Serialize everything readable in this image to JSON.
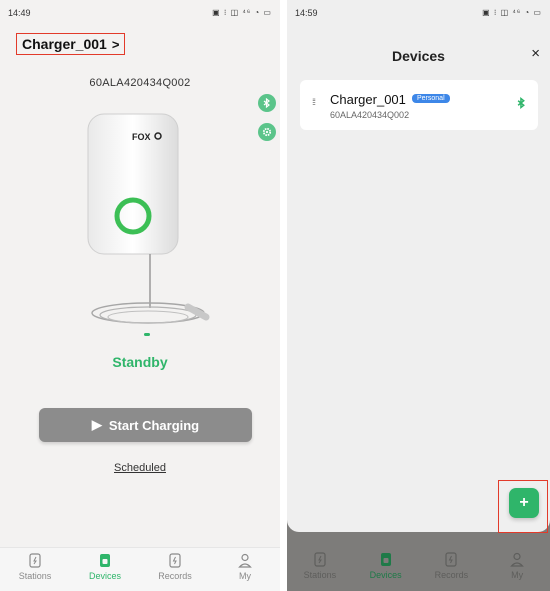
{
  "left": {
    "status_time": "14:49",
    "status_icons": "▣ ⁝ ◫ ⁴⁶ ◔ ▭",
    "charger_name": "Charger_001",
    "chevron": ">",
    "serial": "60ALA420434Q002",
    "device_logo": "FOX",
    "state": "Standby",
    "start_label": "Start Charging",
    "scheduled_label": "Scheduled"
  },
  "right": {
    "status_time": "14:59",
    "status_icons": "▣ ⁝ ◫ ⁴⁶ ◔ ▭",
    "title": "Devices",
    "close": "×",
    "device": {
      "name": "Charger_001",
      "badge": "Personal",
      "serial": "60ALA420434Q002"
    },
    "fab": "+"
  },
  "tabs": [
    {
      "label": "Stations",
      "icon": "station-icon"
    },
    {
      "label": "Devices",
      "icon": "device-icon"
    },
    {
      "label": "Records",
      "icon": "records-icon"
    },
    {
      "label": "My",
      "icon": "user-icon"
    }
  ],
  "colors": {
    "accent": "#2fb56a",
    "badge": "#3d87e8",
    "highlight": "#e23a2a"
  }
}
